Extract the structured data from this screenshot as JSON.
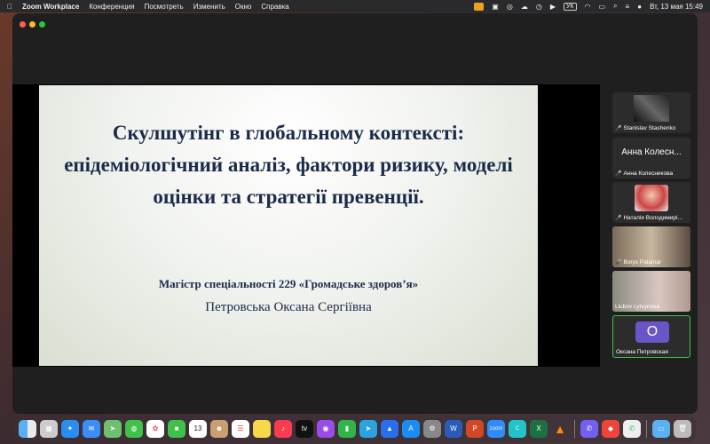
{
  "menubar": {
    "app_name": "Zoom Workplace",
    "items": [
      "Конференция",
      "Посмотреть",
      "Изменить",
      "Окно",
      "Справка"
    ],
    "keyboard_layout": "УК",
    "datetime": "Вт, 13 мая  15:49"
  },
  "slide": {
    "title": "Скулшутінг в глобальному контексті: епідеміологічний аналіз, фактори ризику, моделі оцінки та стратегії превенції.",
    "degree": "Магістр спеціальності 229 «Громадське здоров’я»",
    "author": "Петровська Оксана Сергіївна"
  },
  "participants": [
    {
      "name": "Stanislav Stashenko",
      "muted": true
    },
    {
      "name": "Анна Колесникова",
      "display_text": "Анна Колесн...",
      "muted": true
    },
    {
      "name": "Наталія Володимирі...",
      "muted": true
    },
    {
      "name": "Borys Palamar",
      "muted": true
    },
    {
      "name": "Liubov Lytvynova",
      "muted": false
    },
    {
      "name": "Оксана Петровская",
      "initial": "О",
      "muted": false,
      "active_speaker": true
    }
  ],
  "dock_icons": [
    "finder-icon",
    "launchpad-icon",
    "safari-icon",
    "mail-icon",
    "maps-icon",
    "messages-icon",
    "photos-icon",
    "facetime-icon",
    "calendar-icon",
    "contacts-icon",
    "reminders-icon",
    "notes-icon",
    "music-icon",
    "tv-icon",
    "podcasts-icon",
    "numbers-icon",
    "telegram-icon",
    "keynote-icon",
    "appstore-icon",
    "settings-icon",
    "word-icon",
    "powerpoint-icon",
    "zoom-icon",
    "canva-icon",
    "excel-icon",
    "vlc-icon",
    "viber-icon",
    "anydesk-icon",
    "whatsapp-icon",
    "downloads-folder-icon",
    "trash-icon"
  ],
  "colors": {
    "accent_speaker": "#3ec24a",
    "avatar": "#6a55c8"
  }
}
